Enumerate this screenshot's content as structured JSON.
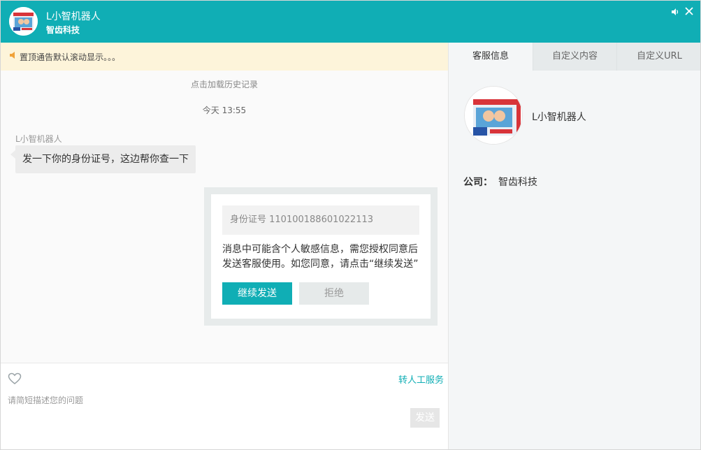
{
  "header": {
    "title": "L小智机器人",
    "subtitle": "智齿科技"
  },
  "notice": {
    "text": "置顶通告默认滚动显示。。。"
  },
  "chat": {
    "load_history": "点击加载历史记录",
    "timestamp": "今天 13:55",
    "sender": "L小智机器人",
    "message": "发一下你的身份证号，这边帮你查一下",
    "consent": {
      "id_text": "身份证号 110100188601022113",
      "notice_line1": "消息中可能含个人敏感信息，需您授权同意后",
      "notice_line2": "发送客服使用。如您同意，请点击“继续发送”",
      "continue_label": "继续发送",
      "reject_label": "拒绝"
    }
  },
  "input": {
    "transfer_label": "转人工服务",
    "placeholder": "请简短描述您的问题",
    "value": "",
    "send_label": "发送"
  },
  "right_panel": {
    "tabs": [
      {
        "label": "客服信息",
        "active": true
      },
      {
        "label": "自定义内容",
        "active": false
      },
      {
        "label": "自定义URL",
        "active": false
      }
    ],
    "profile_name": "L小智机器人",
    "company_label": "公司：",
    "company_value": "智齿科技"
  },
  "colors": {
    "brand": "#10aeb5",
    "notice_bg": "#fdf4da",
    "notice_icon": "#f0a23a"
  },
  "icons": {
    "volume": "volume-icon",
    "close": "close-icon",
    "speaker": "speaker-icon",
    "heart": "heart-icon"
  }
}
